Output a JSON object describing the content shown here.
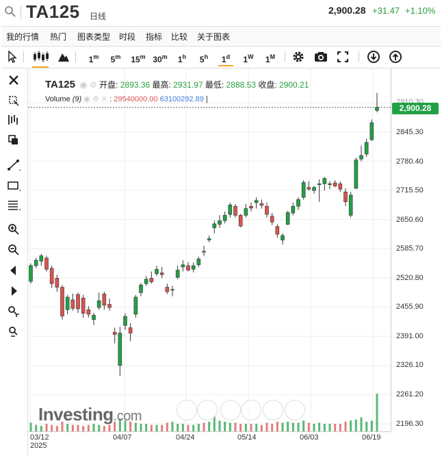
{
  "header": {
    "symbol": "TA125",
    "period": "日线",
    "price": "2,900.28",
    "change": "+31.47",
    "change_pct": "+1.10%"
  },
  "menu": [
    "我的行情",
    "热门",
    "图表类型",
    "时段",
    "指标",
    "比较",
    "关于图表"
  ],
  "toolbar": {
    "intervals": [
      {
        "num": "1",
        "unit": "m"
      },
      {
        "num": "5",
        "unit": "m"
      },
      {
        "num": "15",
        "unit": "m"
      },
      {
        "num": "30",
        "unit": "m"
      },
      {
        "num": "1",
        "unit": "h"
      },
      {
        "num": "5",
        "unit": "h"
      },
      {
        "num": "1",
        "unit": "d"
      },
      {
        "num": "1",
        "unit": "W"
      },
      {
        "num": "1",
        "unit": "M"
      }
    ],
    "active_interval": "1d"
  },
  "legend": {
    "symbol": "TA125",
    "open_label": "开盘:",
    "open": "2893.36",
    "high_label": "最高:",
    "high": "2931.97",
    "low_label": "最低:",
    "low": "2888.53",
    "close_label": "收盘:",
    "close": "2900.21",
    "volume_label": "Volume",
    "volume_param": "(9)",
    "volume_sep": ":",
    "volume_value": "29540000.00",
    "volume_ma": "63100292.89",
    "volume_bar": "|"
  },
  "price_tag": "2,900.28",
  "price_tag_top": "2910.30",
  "y_labels": [
    "2845.30",
    "2780.40",
    "2715.50",
    "2650.60",
    "2585.70",
    "2520.80",
    "2455.90",
    "2391.00",
    "2326.10",
    "2261.20",
    "2196.30"
  ],
  "x_labels": [
    "03/12",
    "04/07",
    "04/24",
    "05/14",
    "06/03",
    "06/19"
  ],
  "x_year": "2025",
  "logo": {
    "main": "Investing",
    "suffix": ".com"
  },
  "colors": {
    "up": "#22a046",
    "down": "#d9534f",
    "accent": "#f5a623"
  },
  "chart_data": {
    "type": "candlestick",
    "x_range": [
      "03/12",
      "06/19"
    ],
    "ylim": [
      2196.3,
      2910.3
    ],
    "candles": [
      {
        "o": 2513,
        "h": 2553,
        "l": 2508,
        "c": 2548
      },
      {
        "o": 2548,
        "h": 2565,
        "l": 2543,
        "c": 2560
      },
      {
        "o": 2558,
        "h": 2574,
        "l": 2548,
        "c": 2570
      },
      {
        "o": 2565,
        "h": 2570,
        "l": 2535,
        "c": 2540
      },
      {
        "o": 2542,
        "h": 2548,
        "l": 2498,
        "c": 2508
      },
      {
        "o": 2520,
        "h": 2528,
        "l": 2490,
        "c": 2500
      },
      {
        "o": 2500,
        "h": 2505,
        "l": 2428,
        "c": 2436
      },
      {
        "o": 2450,
        "h": 2483,
        "l": 2440,
        "c": 2478
      },
      {
        "o": 2472,
        "h": 2486,
        "l": 2448,
        "c": 2453
      },
      {
        "o": 2484,
        "h": 2488,
        "l": 2443,
        "c": 2452
      },
      {
        "o": 2476,
        "h": 2483,
        "l": 2432,
        "c": 2442
      },
      {
        "o": 2450,
        "h": 2458,
        "l": 2433,
        "c": 2440
      },
      {
        "o": 2428,
        "h": 2443,
        "l": 2416,
        "c": 2438
      },
      {
        "o": 2455,
        "h": 2488,
        "l": 2450,
        "c": 2470
      },
      {
        "o": 2485,
        "h": 2490,
        "l": 2450,
        "c": 2460
      },
      {
        "o": 2462,
        "h": 2475,
        "l": 2448,
        "c": 2455
      },
      {
        "o": 2400,
        "h": 2410,
        "l": 2375,
        "c": 2395
      },
      {
        "o": 2326,
        "h": 2412,
        "l": 2303,
        "c": 2398
      },
      {
        "o": 2415,
        "h": 2442,
        "l": 2405,
        "c": 2435
      },
      {
        "o": 2410,
        "h": 2420,
        "l": 2380,
        "c": 2398
      },
      {
        "o": 2440,
        "h": 2483,
        "l": 2432,
        "c": 2478
      },
      {
        "o": 2488,
        "h": 2510,
        "l": 2480,
        "c": 2505
      },
      {
        "o": 2508,
        "h": 2525,
        "l": 2503,
        "c": 2518
      },
      {
        "o": 2520,
        "h": 2535,
        "l": 2508,
        "c": 2512
      },
      {
        "o": 2530,
        "h": 2548,
        "l": 2525,
        "c": 2540
      },
      {
        "o": 2532,
        "h": 2545,
        "l": 2520,
        "c": 2528
      },
      {
        "o": 2500,
        "h": 2508,
        "l": 2485,
        "c": 2490
      },
      {
        "o": 2495,
        "h": 2503,
        "l": 2480,
        "c": 2495
      },
      {
        "o": 2522,
        "h": 2548,
        "l": 2518,
        "c": 2538
      },
      {
        "o": 2545,
        "h": 2560,
        "l": 2535,
        "c": 2550
      },
      {
        "o": 2548,
        "h": 2556,
        "l": 2535,
        "c": 2538
      },
      {
        "o": 2540,
        "h": 2555,
        "l": 2533,
        "c": 2548
      },
      {
        "o": 2550,
        "h": 2568,
        "l": 2545,
        "c": 2563
      },
      {
        "o": 2580,
        "h": 2592,
        "l": 2570,
        "c": 2578
      },
      {
        "o": 2605,
        "h": 2615,
        "l": 2600,
        "c": 2608
      },
      {
        "o": 2632,
        "h": 2648,
        "l": 2620,
        "c": 2641
      },
      {
        "o": 2640,
        "h": 2660,
        "l": 2632,
        "c": 2648
      },
      {
        "o": 2648,
        "h": 2668,
        "l": 2642,
        "c": 2660
      },
      {
        "o": 2662,
        "h": 2688,
        "l": 2655,
        "c": 2683
      },
      {
        "o": 2680,
        "h": 2685,
        "l": 2655,
        "c": 2660
      },
      {
        "o": 2660,
        "h": 2663,
        "l": 2633,
        "c": 2636
      },
      {
        "o": 2660,
        "h": 2685,
        "l": 2655,
        "c": 2675
      },
      {
        "o": 2680,
        "h": 2688,
        "l": 2668,
        "c": 2676
      },
      {
        "o": 2688,
        "h": 2700,
        "l": 2675,
        "c": 2693
      },
      {
        "o": 2686,
        "h": 2695,
        "l": 2675,
        "c": 2682
      },
      {
        "o": 2680,
        "h": 2688,
        "l": 2655,
        "c": 2662
      },
      {
        "o": 2658,
        "h": 2665,
        "l": 2638,
        "c": 2645
      },
      {
        "o": 2635,
        "h": 2640,
        "l": 2610,
        "c": 2618
      },
      {
        "o": 2605,
        "h": 2620,
        "l": 2595,
        "c": 2615
      },
      {
        "o": 2640,
        "h": 2670,
        "l": 2638,
        "c": 2666
      },
      {
        "o": 2665,
        "h": 2688,
        "l": 2660,
        "c": 2680
      },
      {
        "o": 2680,
        "h": 2700,
        "l": 2672,
        "c": 2695
      },
      {
        "o": 2700,
        "h": 2738,
        "l": 2695,
        "c": 2733
      },
      {
        "o": 2722,
        "h": 2736,
        "l": 2715,
        "c": 2718
      },
      {
        "o": 2715,
        "h": 2725,
        "l": 2708,
        "c": 2722
      },
      {
        "o": 2728,
        "h": 2740,
        "l": 2690,
        "c": 2730
      },
      {
        "o": 2730,
        "h": 2745,
        "l": 2715,
        "c": 2742
      },
      {
        "o": 2728,
        "h": 2736,
        "l": 2718,
        "c": 2730
      },
      {
        "o": 2732,
        "h": 2738,
        "l": 2722,
        "c": 2725
      },
      {
        "o": 2730,
        "h": 2735,
        "l": 2712,
        "c": 2718
      },
      {
        "o": 2712,
        "h": 2720,
        "l": 2680,
        "c": 2690
      },
      {
        "o": 2660,
        "h": 2712,
        "l": 2655,
        "c": 2705
      },
      {
        "o": 2720,
        "h": 2788,
        "l": 2718,
        "c": 2783
      },
      {
        "o": 2785,
        "h": 2815,
        "l": 2780,
        "c": 2793
      },
      {
        "o": 2796,
        "h": 2830,
        "l": 2790,
        "c": 2822
      },
      {
        "o": 2828,
        "h": 2873,
        "l": 2825,
        "c": 2866
      },
      {
        "o": 2893,
        "h": 2932,
        "l": 2889,
        "c": 2900
      }
    ],
    "volume": [
      8,
      6,
      5,
      7,
      6,
      5,
      9,
      7,
      6,
      6,
      5,
      6,
      7,
      6,
      5,
      6,
      9,
      12,
      10,
      9,
      8,
      7,
      7,
      6,
      6,
      6,
      8,
      9,
      7,
      7,
      6,
      6,
      7,
      8,
      9,
      14,
      10,
      9,
      8,
      8,
      7,
      7,
      7,
      7,
      6,
      8,
      7,
      9,
      8,
      9,
      8,
      8,
      10,
      8,
      7,
      8,
      7,
      7,
      7,
      7,
      9,
      10,
      11,
      13,
      9,
      10,
      35
    ]
  }
}
